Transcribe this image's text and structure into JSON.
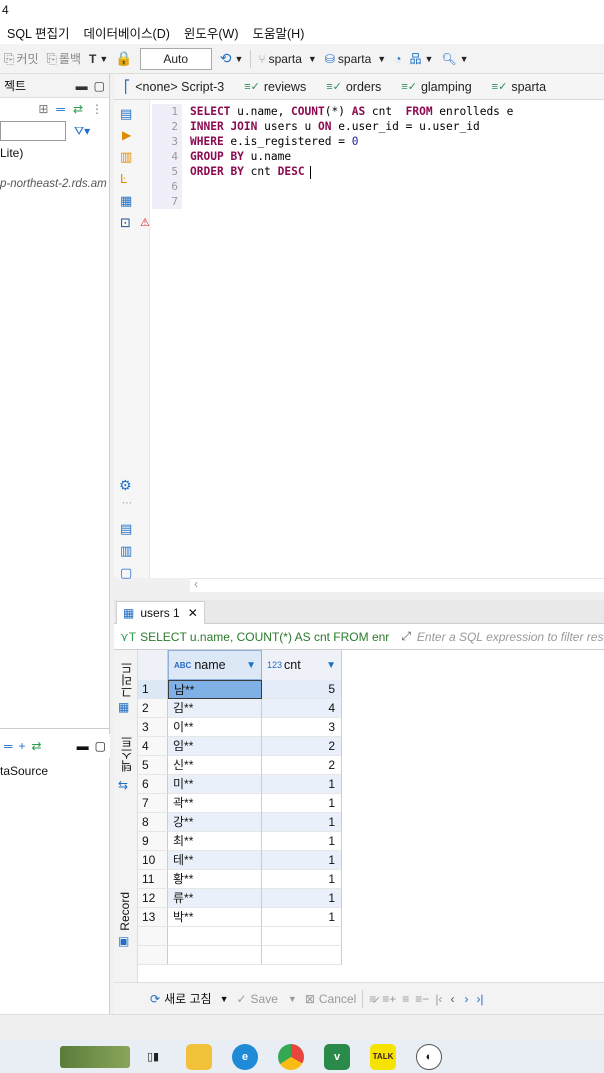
{
  "window": {
    "title_fragment": "4"
  },
  "menu": [
    "SQL 편집기",
    "데이터베이스(D)",
    "윈도우(W)",
    "도움말(H)"
  ],
  "toolbar": {
    "commit": "커밋",
    "rollback": "롤백",
    "transaction_mode": "Auto",
    "datasource": "sparta",
    "schema": "sparta"
  },
  "left_panel": {
    "header": "젝트",
    "tree_item_1": "Lite)",
    "tree_item_2": "p-northeast-2.rds.am",
    "second_item": "taSource"
  },
  "editor_tabs": [
    {
      "label": "<none> Script-3"
    },
    {
      "label": "reviews"
    },
    {
      "label": "orders"
    },
    {
      "label": "glamping"
    },
    {
      "label": "sparta"
    }
  ],
  "editor": {
    "line_numbers": [
      "1",
      "2",
      "3",
      "4",
      "5",
      "6",
      "7"
    ],
    "lines": [
      "SELECT u.name, COUNT(*) AS cnt  FROM enrolleds e",
      "INNER JOIN users u ON e.user_id = u.user_id",
      "WHERE e.is_registered = 0",
      "GROUP BY u.name",
      "ORDER BY cnt DESC",
      "",
      ""
    ]
  },
  "results": {
    "tab_label": "users 1",
    "query_preview": "SELECT u.name, COUNT(*) AS cnt FROM enr",
    "filter_placeholder": "Enter a SQL expression to filter results",
    "side_tabs": [
      "그리드",
      "텍스트",
      "Record"
    ],
    "columns": [
      {
        "type": "ABC",
        "name": "name"
      },
      {
        "type": "123",
        "name": "cnt"
      }
    ],
    "rows": [
      {
        "n": "1",
        "name": "남**",
        "cnt": "5"
      },
      {
        "n": "2",
        "name": "김**",
        "cnt": "4"
      },
      {
        "n": "3",
        "name": "이**",
        "cnt": "3"
      },
      {
        "n": "4",
        "name": "임**",
        "cnt": "2"
      },
      {
        "n": "5",
        "name": "신**",
        "cnt": "2"
      },
      {
        "n": "6",
        "name": "미**",
        "cnt": "1"
      },
      {
        "n": "7",
        "name": "곽**",
        "cnt": "1"
      },
      {
        "n": "8",
        "name": "강**",
        "cnt": "1"
      },
      {
        "n": "9",
        "name": "최**",
        "cnt": "1"
      },
      {
        "n": "10",
        "name": "테**",
        "cnt": "1"
      },
      {
        "n": "11",
        "name": "황**",
        "cnt": "1"
      },
      {
        "n": "12",
        "name": "류**",
        "cnt": "1"
      },
      {
        "n": "13",
        "name": "박**",
        "cnt": "1"
      }
    ],
    "refresh_label": "새로 고침",
    "save_label": "Save",
    "cancel_label": "Cancel"
  },
  "colors": {
    "accent": "#0f6fc6",
    "keyword": "#8b0a50",
    "selected_row": "#dde8f6"
  }
}
